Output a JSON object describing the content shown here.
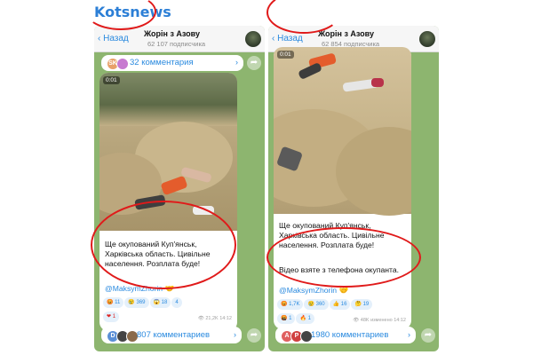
{
  "brand": "Kotsnews",
  "colors": {
    "link": "#2a8adf",
    "brand": "#2c7fd6",
    "annotation": "#e01a1a",
    "chat_bg": "#8db56f"
  },
  "left": {
    "back_label": "Назад",
    "title": "Жорін з Азову",
    "subscribers": "62 107 подписчика",
    "top_comments": "32 комментария",
    "video_time": "0:01",
    "message": [
      "Ще окупований Куп'янськ,",
      "Харківська область. Цивільне",
      "населення. Розплата буде!"
    ],
    "link": "@MaksymZhorin 🤝",
    "reactions": [
      "😡 11",
      "😢 369",
      "😱 18",
      "4"
    ],
    "reactions2": [
      "❤ 1"
    ],
    "meta": "👁 21,2K 14:12",
    "bottom_comments": "807 комментариев"
  },
  "right": {
    "back_label": "Назад",
    "title": "Жорін з Азову",
    "subscribers": "62 854 подписчика",
    "video_time": "0:01",
    "message": [
      "Ще окупований Куп'янськ,",
      "Харківська область. Цивільне",
      "населення. Розплата буде!"
    ],
    "message2": "Відео взяте з телефона окупанта.",
    "link": "@MaksymZhorin 🤝",
    "reactions": [
      "😡 1,7K",
      "😢 360",
      "👍 16",
      "🤔 19"
    ],
    "reactions2": [
      "🤬 1",
      "🔥 1"
    ],
    "meta": "👁 48K изменено 14:12",
    "bottom_comments": "1980 комментариев"
  }
}
